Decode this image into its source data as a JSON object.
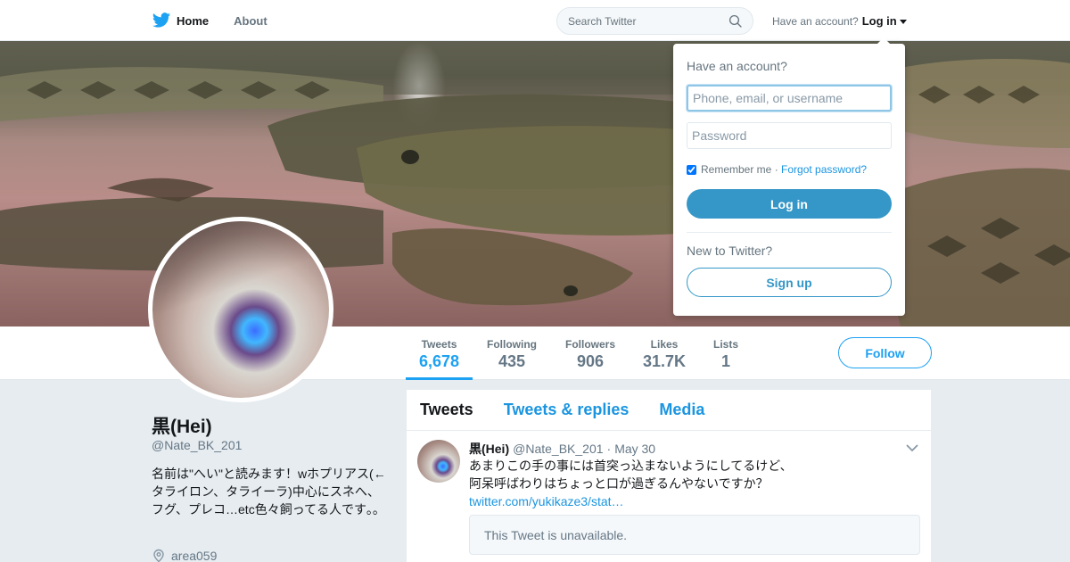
{
  "nav": {
    "home_label": "Home",
    "about_label": "About",
    "search_placeholder": "Search Twitter",
    "account_prompt": "Have an account?",
    "login_label": "Log in"
  },
  "colors": {
    "accent": "#1da1f2",
    "link": "#1b95e0",
    "login_button": "#3597c8"
  },
  "profile": {
    "name": "黒(Hei)",
    "handle": "@Nate_BK_201",
    "bio": "名前は\"へい\"と読みます！wホプリアス(←タライロン、タライーラ)中心にスネへ、フグ、プレコ…etc色々飼ってる人です｡｡",
    "location": "area059"
  },
  "stats": [
    {
      "label": "Tweets",
      "value": "6,678"
    },
    {
      "label": "Following",
      "value": "435"
    },
    {
      "label": "Followers",
      "value": "906"
    },
    {
      "label": "Likes",
      "value": "31.7K"
    },
    {
      "label": "Lists",
      "value": "1"
    }
  ],
  "follow_label": "Follow",
  "timeline": {
    "tabs": [
      "Tweets",
      "Tweets & replies",
      "Media"
    ],
    "tweet": {
      "name": "黒(Hei)",
      "handle": "@Nate_BK_201",
      "date": "May 30",
      "line1": "あまりこの手の事には首突っ込まないようにしてるけど、",
      "line2": "阿呆呼ばわりはちょっと口が過ぎるんやないですか？",
      "link": "twitter.com/yukikaze3/stat…",
      "quote": "This Tweet is unavailable."
    }
  },
  "login_dropdown": {
    "title": "Have an account?",
    "username_placeholder": "Phone, email, or username",
    "password_placeholder": "Password",
    "remember_label": "Remember me",
    "remember_checked": true,
    "forgot_label": "Forgot password?",
    "login_button": "Log in",
    "new_prompt": "New to Twitter?",
    "signup_button": "Sign up"
  }
}
